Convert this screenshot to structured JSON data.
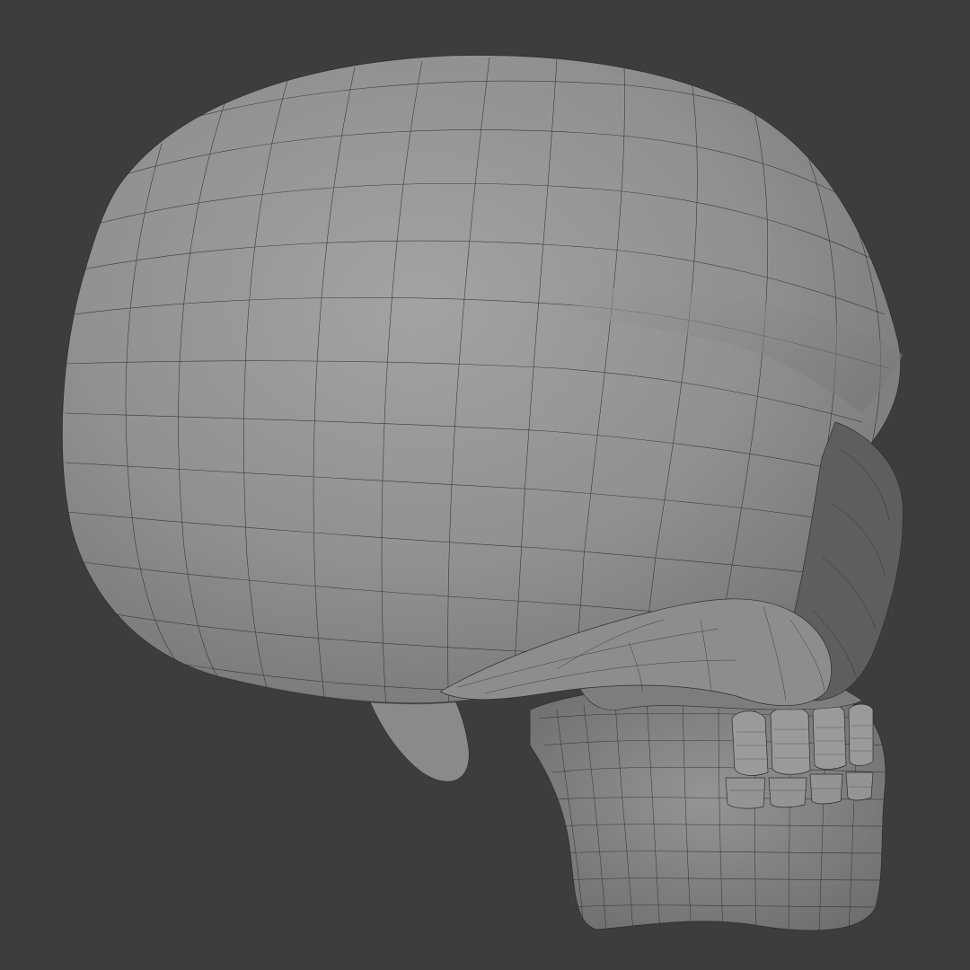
{
  "viewport": {
    "background_color": "#3d3d3d",
    "mesh_color": "#8a8a8a",
    "wire_color": "#2b2b2b"
  },
  "subject": {
    "icon": "skull-wireframe-icon"
  }
}
